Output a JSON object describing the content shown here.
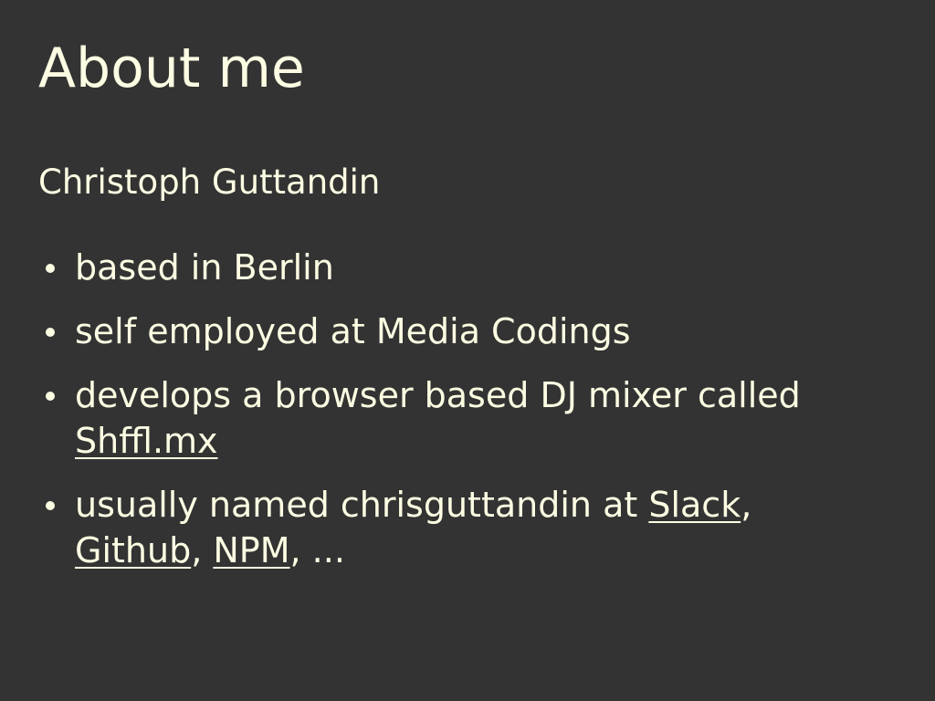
{
  "slide": {
    "title": "About me",
    "subtitle": "Christoph Guttandin",
    "bullets": [
      {
        "text": "based in Berlin"
      },
      {
        "text": "self employed at Media Codings"
      },
      {
        "text_before": "develops a browser based DJ mixer called ",
        "link": "Shffl.mx"
      },
      {
        "text_before": "usually named chrisguttandin at ",
        "links": [
          "Slack",
          "Github",
          "NPM"
        ],
        "separator": ", ",
        "text_after": ", ..."
      }
    ]
  },
  "colors": {
    "background": "#333333",
    "text": "#fdfde3"
  }
}
